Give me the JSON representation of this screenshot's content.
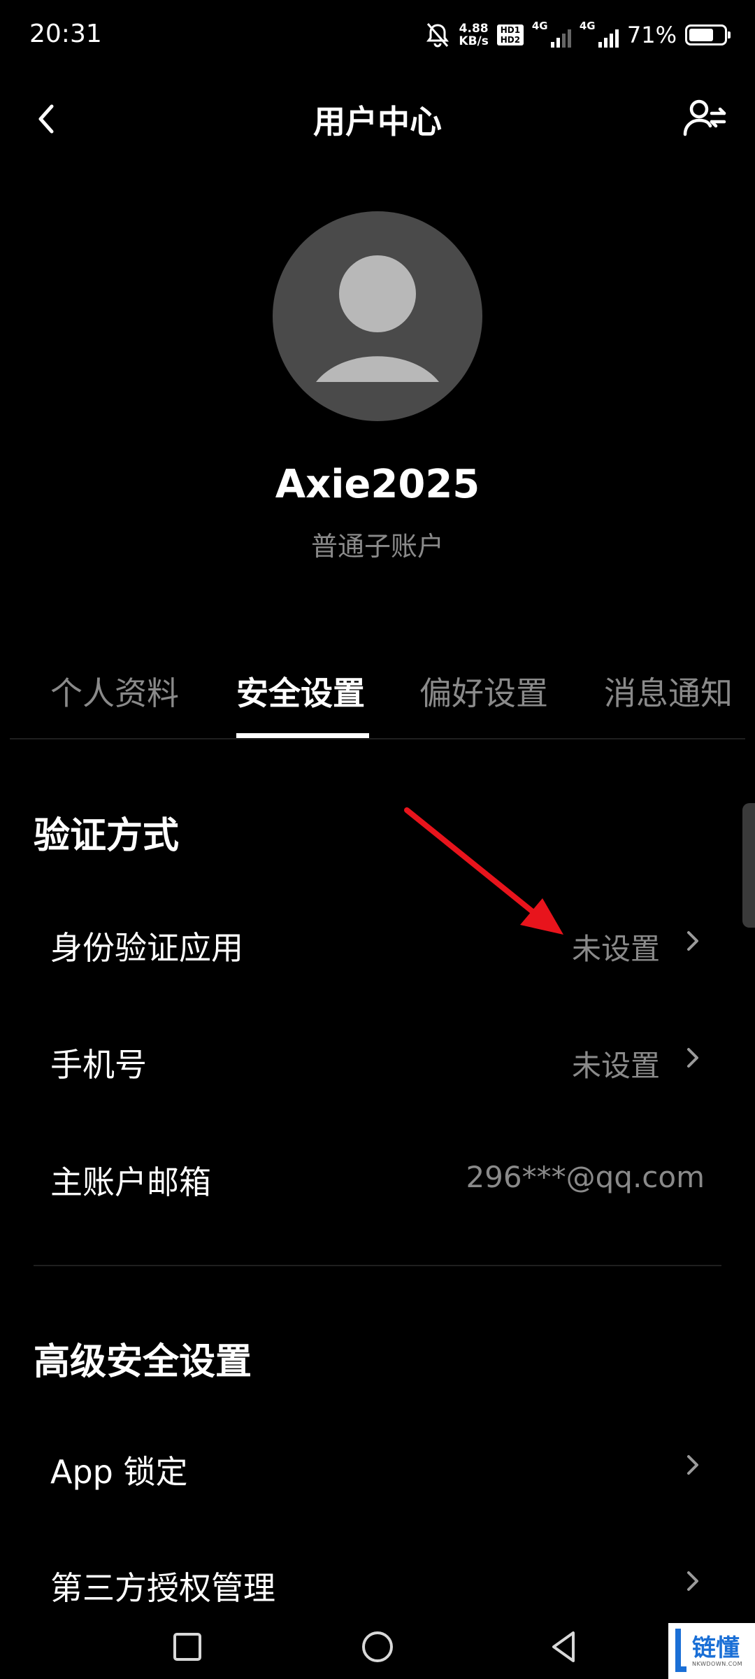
{
  "status_bar": {
    "time": "20:31",
    "net_speed_value": "4.88",
    "net_speed_unit": "KB/s",
    "hd_top": "HD1",
    "hd_bottom": "HD2",
    "network_type_1": "4G",
    "network_type_2": "4G",
    "battery_percent": "71%",
    "battery_level": 0.71
  },
  "header": {
    "title": "用户中心",
    "back_icon": "chevron-left-icon",
    "switch_icon": "switch-user-icon"
  },
  "profile": {
    "username": "Axie2025",
    "account_type": "普通子账户",
    "avatar_icon": "default-avatar-icon"
  },
  "tabs": [
    {
      "label": "个人资料",
      "active": false
    },
    {
      "label": "安全设置",
      "active": true
    },
    {
      "label": "偏好设置",
      "active": false
    },
    {
      "label": "消息通知",
      "active": false
    }
  ],
  "sections": [
    {
      "title": "验证方式",
      "rows": [
        {
          "label": "身份验证应用",
          "value": "未设置",
          "has_chevron": true
        },
        {
          "label": "手机号",
          "value": "未设置",
          "has_chevron": true
        },
        {
          "label": "主账户邮箱",
          "value": "296***@qq.com",
          "has_chevron": false
        }
      ]
    },
    {
      "title": "高级安全设置",
      "rows": [
        {
          "label": "App 锁定",
          "value": "",
          "has_chevron": true
        },
        {
          "label": "第三方授权管理",
          "value": "",
          "has_chevron": true
        }
      ]
    }
  ],
  "annotation": {
    "arrow_color": "#e8141c"
  },
  "nav_bar": {
    "recents_icon": "square-recents-icon",
    "home_icon": "circle-home-icon",
    "back_icon": "triangle-back-icon"
  },
  "watermark": {
    "text": "链懂",
    "sub": "NKWDOWN.COM"
  }
}
